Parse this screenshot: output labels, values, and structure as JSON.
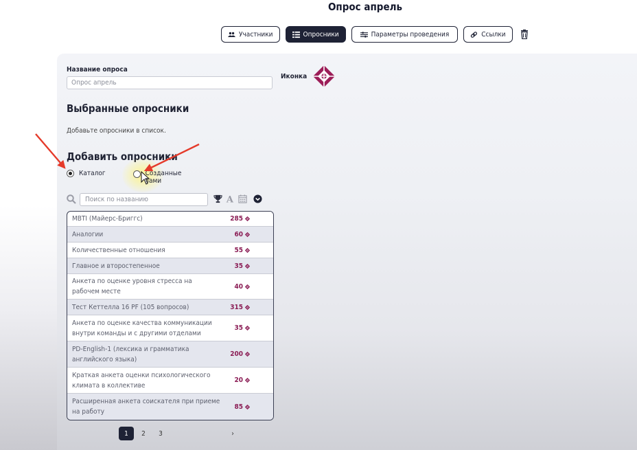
{
  "header": {
    "title": "Опрос апрель"
  },
  "tabs": [
    {
      "label": "Участники",
      "icon": "users-icon",
      "active": false
    },
    {
      "label": "Опросники",
      "icon": "list-icon",
      "active": true
    },
    {
      "label": "Параметры проведения",
      "icon": "sliders-icon",
      "active": false
    },
    {
      "label": "Ссылки",
      "icon": "link-icon",
      "active": false
    }
  ],
  "form": {
    "name_label": "Название опроса",
    "name_value": "Опрос апрель",
    "icon_label": "Иконка"
  },
  "selected": {
    "title": "Выбранные опросники",
    "hint": "Добавьте опросники в список."
  },
  "add": {
    "title": "Добавить опросники",
    "radio_catalog": "Каталог",
    "radio_created": "Созданные вами",
    "search_placeholder": "Поиск по названию"
  },
  "surveys": [
    {
      "name": "MBTI (Майерс-Бриггс)",
      "price": "285"
    },
    {
      "name": "Аналогии",
      "price": "60"
    },
    {
      "name": "Количественные отношения",
      "price": "55"
    },
    {
      "name": "Главное и второстепенное",
      "price": "35"
    },
    {
      "name": "Анкета по оценке уровня стресса на рабочем месте",
      "price": "40"
    },
    {
      "name": "Тест Кеттелла 16 PF (105 вопросов)",
      "price": "315"
    },
    {
      "name": "Анкета по оценке качества коммуникации внутри команды и с другими отделами",
      "price": "35"
    },
    {
      "name": "PD-English-1 (лексика и грамматика английского языка)",
      "price": "200"
    },
    {
      "name": "Краткая анкета оценки психологического климата в коллективе",
      "price": "20"
    },
    {
      "name": "Расширенная анкета соискателя при приеме на работу",
      "price": "85"
    }
  ],
  "pagination": {
    "pages": [
      "1",
      "2",
      "3"
    ],
    "current": "1",
    "next": "›"
  },
  "colors": {
    "accent_dark": "#1e2235",
    "price": "#8b1d55",
    "logo": "#9c1e58",
    "arrow": "#e53a2a"
  }
}
